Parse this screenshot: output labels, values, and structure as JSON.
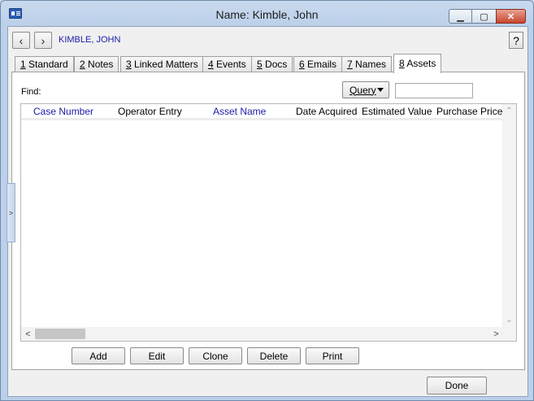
{
  "window": {
    "title": "Name: Kimble, John",
    "controls": {
      "minimize": "▁",
      "maximize": "▢",
      "close": "✕"
    }
  },
  "header": {
    "prev": "‹",
    "next": "›",
    "record_name": "KIMBLE, JOHN",
    "help": "?"
  },
  "tabs": [
    {
      "mnemonic": "1",
      "label": " Standard"
    },
    {
      "mnemonic": "2",
      "label": " Notes"
    },
    {
      "mnemonic": "3",
      "label": " Linked Matters"
    },
    {
      "mnemonic": "4",
      "label": " Events"
    },
    {
      "mnemonic": "5",
      "label": " Docs"
    },
    {
      "mnemonic": "6",
      "label": " Emails"
    },
    {
      "mnemonic": "7",
      "label": " Names"
    },
    {
      "mnemonic": "8",
      "label": " Assets"
    }
  ],
  "active_tab": "8 Assets",
  "find": {
    "label": "Find:",
    "query_label": "Query",
    "value": ""
  },
  "grid": {
    "columns": [
      "Case Number",
      "Operator Entry",
      "Asset Name",
      "Date Acquired",
      "Estimated Value",
      "Purchase Price"
    ],
    "rows": []
  },
  "buttons": {
    "add": "Add",
    "edit": "Edit",
    "clone": "Clone",
    "delete": "Delete",
    "print": "Print",
    "done": "Done"
  },
  "side_handle": ">",
  "colors": {
    "link": "#1a1aa8",
    "title_bar": "#bcd0ea",
    "close_button": "#c8452b"
  }
}
